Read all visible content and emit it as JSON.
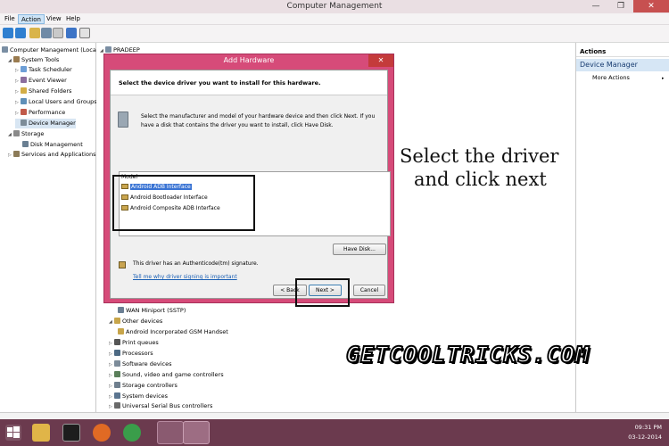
{
  "window": {
    "title": "Computer Management",
    "controls": {
      "minimize": "—",
      "maximize": "❐",
      "close": "✕"
    }
  },
  "menubar": {
    "items": [
      "File",
      "Action",
      "View",
      "Help"
    ],
    "active": "Action"
  },
  "toolbar": {
    "icons": [
      "back-icon",
      "forward-icon",
      "up-icon",
      "show-hide-tree-icon",
      "properties-icon",
      "help-icon",
      "show-pane-icon",
      "refresh-icon"
    ]
  },
  "left_tree": {
    "root": "Computer Management (Local",
    "items": [
      {
        "label": "System Tools",
        "level": 1
      },
      {
        "label": "Task Scheduler",
        "level": 2
      },
      {
        "label": "Event Viewer",
        "level": 2
      },
      {
        "label": "Shared Folders",
        "level": 2
      },
      {
        "label": "Local Users and Groups",
        "level": 2
      },
      {
        "label": "Performance",
        "level": 2
      },
      {
        "label": "Device Manager",
        "level": 2
      },
      {
        "label": "Storage",
        "level": 1
      },
      {
        "label": "Disk Management",
        "level": 2
      },
      {
        "label": "Services and Applications",
        "level": 1
      }
    ]
  },
  "center": {
    "root": "PRADEEP",
    "devices": [
      {
        "label": "WAN Miniport (SSTP)",
        "level": 2
      },
      {
        "label": "Other devices",
        "level": 1
      },
      {
        "label": "Android Incorporated GSM Handset",
        "level": 2
      },
      {
        "label": "Print queues",
        "level": 1
      },
      {
        "label": "Processors",
        "level": 1
      },
      {
        "label": "Software devices",
        "level": 1
      },
      {
        "label": "Sound, video and game controllers",
        "level": 1
      },
      {
        "label": "Storage controllers",
        "level": 1
      },
      {
        "label": "System devices",
        "level": 1
      },
      {
        "label": "Universal Serial Bus controllers",
        "level": 1
      }
    ]
  },
  "actions": {
    "header": "Actions",
    "section": "Device Manager",
    "more": "More Actions"
  },
  "dialog": {
    "title": "Add Hardware",
    "close": "✕",
    "heading": "Select the device driver you want to install for this hardware.",
    "info": "Select the manufacturer and model of your hardware device and then click Next. If you have a disk that contains the driver you want to install, click Have Disk.",
    "model_header": "Model",
    "models": [
      {
        "label": "Android ADB Interface",
        "selected": true
      },
      {
        "label": "Android Bootloader Interface",
        "selected": false
      },
      {
        "label": "Android Composite ADB Interface",
        "selected": false
      }
    ],
    "signature_text": "This driver has an Authenticode(tm) signature.",
    "signature_link": "Tell me why driver signing is important",
    "have_disk": "Have Disk...",
    "back": "< Back",
    "next": "Next >",
    "cancel": "Cancel"
  },
  "annotation": {
    "line1": "Select the driver",
    "line2": "and click next",
    "watermark": "GETCOOLTRICKS.COM"
  },
  "taskbar": {
    "time": "09:31 PM",
    "date": "03-12-2014",
    "apps": [
      "file-explorer-icon",
      "media-player-icon",
      "firefox-icon",
      "chrome-icon",
      "computer-management-icon"
    ]
  },
  "colors": {
    "dialog_frame": "#d64b79",
    "taskbar": "#6b3a4e",
    "selection": "#3a74d4"
  }
}
